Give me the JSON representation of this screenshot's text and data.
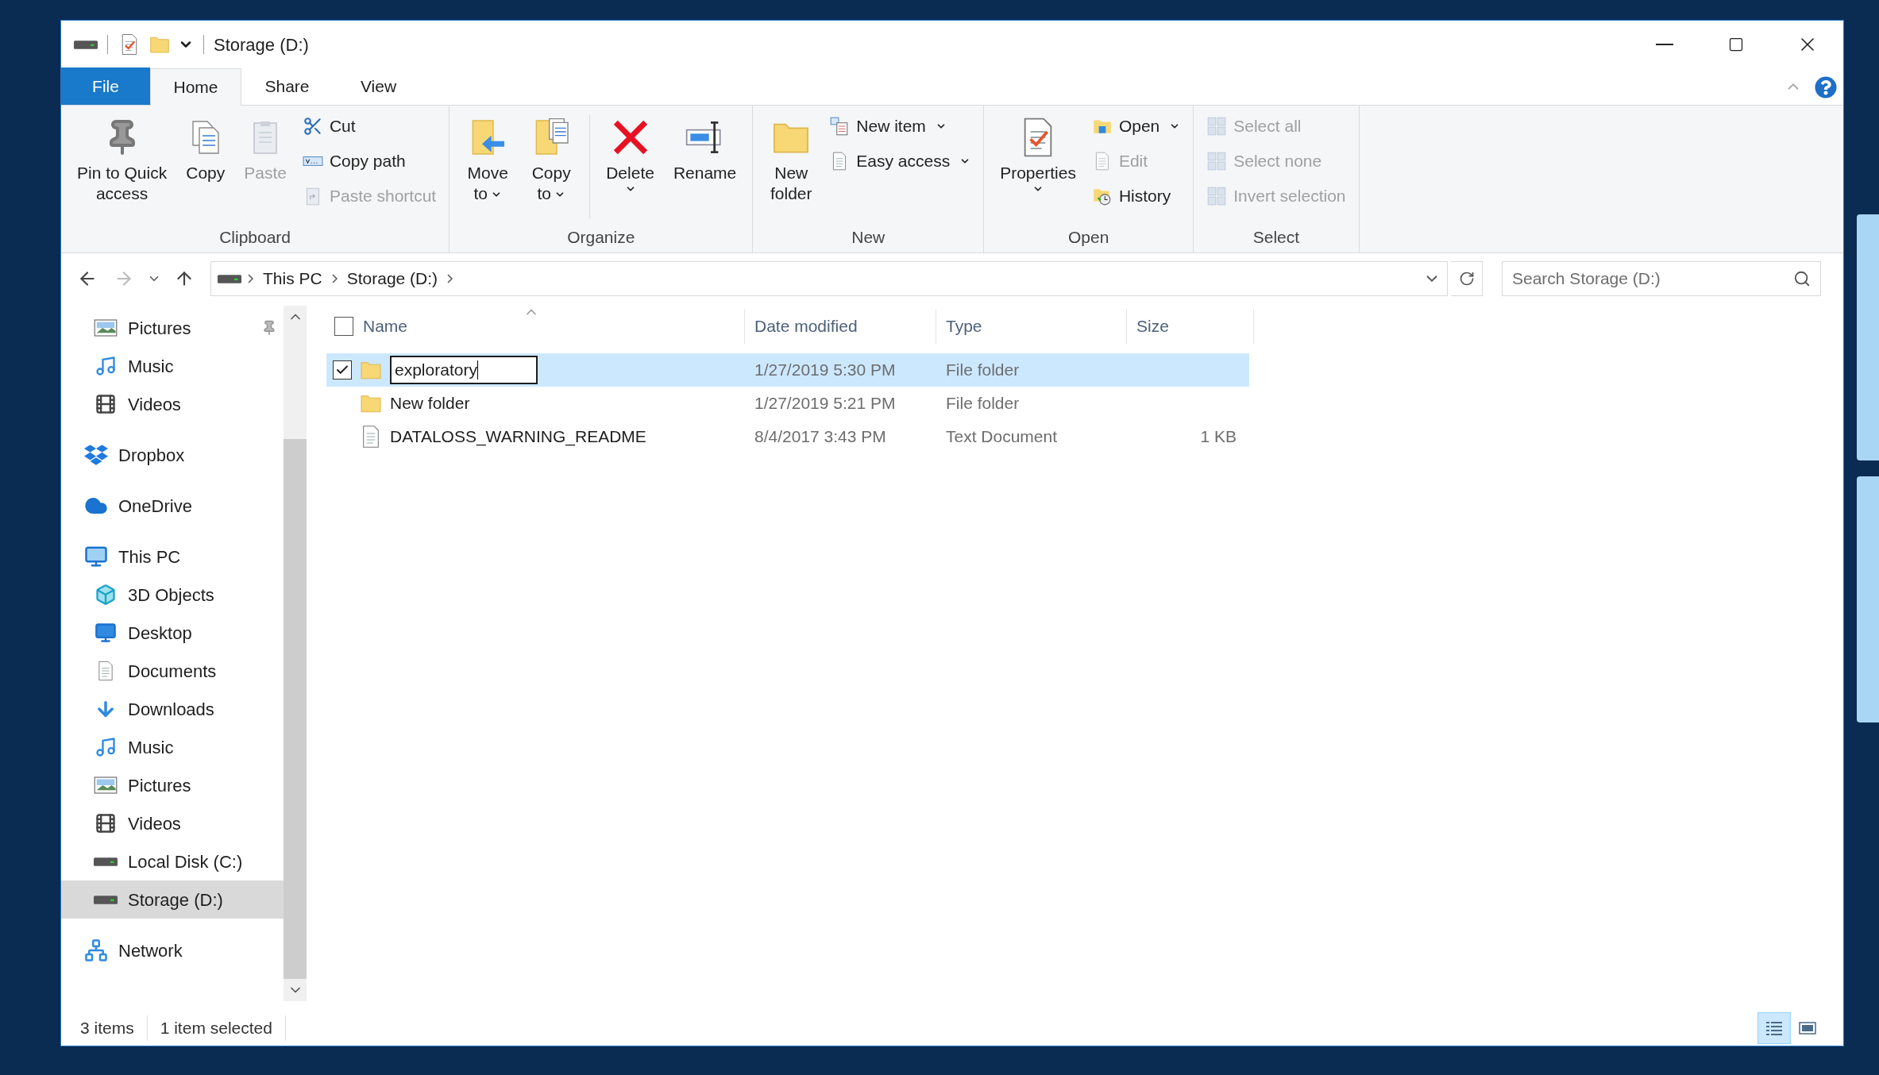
{
  "window": {
    "title": "Storage (D:)"
  },
  "ribbon": {
    "tabs": [
      {
        "label": "File",
        "kind": "menu",
        "selected": false
      },
      {
        "label": "Home",
        "kind": "tab",
        "selected": true
      },
      {
        "label": "Share",
        "kind": "tab",
        "selected": false
      },
      {
        "label": "View",
        "kind": "tab",
        "selected": false
      }
    ],
    "groups": [
      {
        "label": "Clipboard",
        "buttons": [
          {
            "kind": "large",
            "label": "Pin to Quick\naccess",
            "dropdown": false,
            "disabled": false
          },
          {
            "kind": "large",
            "label": "Copy",
            "dropdown": false,
            "disabled": false
          },
          {
            "kind": "large",
            "label": "Paste",
            "dropdown": false,
            "disabled": true
          },
          {
            "kind": "small",
            "label": "Cut",
            "dropdown": false,
            "disabled": false
          },
          {
            "kind": "small",
            "label": "Copy path",
            "dropdown": false,
            "disabled": false
          },
          {
            "kind": "small",
            "label": "Paste shortcut",
            "dropdown": false,
            "disabled": true
          }
        ]
      },
      {
        "label": "Organize",
        "buttons": [
          {
            "kind": "large",
            "label": "Move\nto",
            "dropdown": true,
            "disabled": false
          },
          {
            "kind": "large",
            "label": "Copy\nto",
            "dropdown": true,
            "disabled": false
          },
          {
            "kind": "separator"
          },
          {
            "kind": "large",
            "label": "Delete",
            "dropdown": true,
            "disabled": false
          },
          {
            "kind": "large",
            "label": "Rename",
            "dropdown": false,
            "disabled": false
          }
        ]
      },
      {
        "label": "New",
        "buttons": [
          {
            "kind": "large",
            "label": "New\nfolder",
            "dropdown": false,
            "disabled": false
          },
          {
            "kind": "small",
            "label": "New item",
            "dropdown": true,
            "disabled": false
          },
          {
            "kind": "small",
            "label": "Easy access",
            "dropdown": true,
            "disabled": false
          }
        ]
      },
      {
        "label": "Open",
        "buttons": [
          {
            "kind": "large",
            "label": "Properties",
            "dropdown": true,
            "disabled": false
          },
          {
            "kind": "small",
            "label": "Open",
            "dropdown": true,
            "disabled": false
          },
          {
            "kind": "small",
            "label": "Edit",
            "dropdown": false,
            "disabled": true
          },
          {
            "kind": "small",
            "label": "History",
            "dropdown": false,
            "disabled": false
          }
        ]
      },
      {
        "label": "Select",
        "buttons": [
          {
            "kind": "small",
            "label": "Select all",
            "dropdown": false,
            "disabled": true
          },
          {
            "kind": "small",
            "label": "Select none",
            "dropdown": false,
            "disabled": true
          },
          {
            "kind": "small",
            "label": "Invert selection",
            "dropdown": false,
            "disabled": true
          }
        ]
      }
    ]
  },
  "address_bar": {
    "forward_disabled": true,
    "crumbs": [
      "This PC",
      "Storage (D:)"
    ]
  },
  "search": {
    "placeholder": "Search Storage (D:)"
  },
  "nav_pane": {
    "quick_access_items": [
      {
        "label": "Pictures",
        "pinned": true,
        "selected": false
      },
      {
        "label": "Music",
        "pinned": false,
        "selected": false
      },
      {
        "label": "Videos",
        "pinned": false,
        "selected": false
      }
    ],
    "items": [
      {
        "label": "Dropbox",
        "selected": false
      },
      {
        "label": "OneDrive",
        "selected": false
      },
      {
        "label": "This PC",
        "selected": false,
        "children": [
          {
            "label": "3D Objects",
            "selected": false
          },
          {
            "label": "Desktop",
            "selected": false
          },
          {
            "label": "Documents",
            "selected": false
          },
          {
            "label": "Downloads",
            "selected": false
          },
          {
            "label": "Music",
            "selected": false
          },
          {
            "label": "Pictures",
            "selected": false
          },
          {
            "label": "Videos",
            "selected": false
          },
          {
            "label": "Local Disk (C:)",
            "selected": false
          },
          {
            "label": "Storage (D:)",
            "selected": true
          }
        ]
      },
      {
        "label": "Network",
        "selected": false
      }
    ]
  },
  "file_list": {
    "header_checked": false,
    "columns": [
      {
        "label": "Name",
        "sorted": true
      },
      {
        "label": "Date modified",
        "sorted": false
      },
      {
        "label": "Type",
        "sorted": false
      },
      {
        "label": "Size",
        "sorted": false
      }
    ],
    "rows": [
      {
        "kind": "folder",
        "name": "exploratory",
        "date": "1/27/2019 5:30 PM",
        "type": "File folder",
        "selected": true,
        "checked": true,
        "editing": true
      },
      {
        "kind": "folder",
        "name": "New folder",
        "date": "1/27/2019 5:21 PM",
        "type": "File folder",
        "selected": false,
        "checked": false,
        "editing": false
      },
      {
        "kind": "document",
        "name": "DATALOSS_WARNING_README",
        "date": "8/4/2017 3:43 PM",
        "type": "Text Document",
        "size": "1 KB",
        "selected": false,
        "checked": false,
        "editing": false
      }
    ]
  },
  "status_bar": {
    "item_count": "3 items",
    "selection": "1 item selected",
    "view_buttons": [
      {
        "selected": true
      },
      {
        "selected": false
      }
    ]
  }
}
